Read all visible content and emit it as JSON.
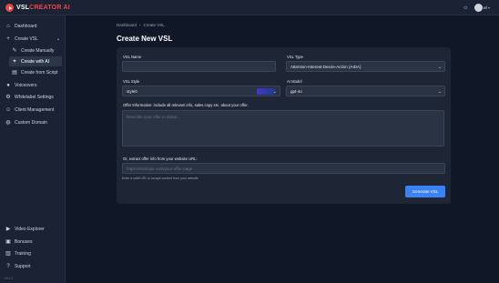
{
  "brand": {
    "name_part1": "VSL",
    "name_part2": "CREATOR AI",
    "color_accent": "#ef4444"
  },
  "topbar": {
    "user_name": "wl",
    "theme_icon": "sun-icon"
  },
  "sidebar": {
    "items": [
      {
        "label": "Dashboard",
        "icon": "home-icon"
      },
      {
        "label": "Create VSL",
        "icon": "plus-icon",
        "expanded": true
      },
      {
        "label": "Create Manually",
        "icon": "edit-icon"
      },
      {
        "label": "Create with AI",
        "icon": "sparkle-icon",
        "active": true
      },
      {
        "label": "Create from Script",
        "icon": "document-icon"
      },
      {
        "label": "Voiceovers",
        "icon": "microphone-icon"
      },
      {
        "label": "Whitelabel Settings",
        "icon": "gear-icon"
      },
      {
        "label": "Client Management",
        "icon": "users-icon"
      },
      {
        "label": "Custom Domain",
        "icon": "globe-icon"
      }
    ],
    "bottom_items": [
      {
        "label": "Video Explorer",
        "icon": "video-icon"
      },
      {
        "label": "Bonuses",
        "icon": "gift-icon"
      },
      {
        "label": "Training",
        "icon": "book-icon"
      },
      {
        "label": "Support",
        "icon": "help-icon"
      }
    ],
    "version": "v0.1.1"
  },
  "breadcrumb": {
    "home": "Dashboard",
    "separator": "›",
    "current": "Create VSL"
  },
  "page_title": "Create New VSL",
  "form": {
    "vsl_name": {
      "label": "VSL Name",
      "value": ""
    },
    "vsl_type": {
      "label": "VSL Type",
      "value": "Attention-Interest-Desire-Action (AIDA)"
    },
    "vsl_style": {
      "label": "VSL Style",
      "value": "style0",
      "swatch_color": "#4338ca"
    },
    "ai_model": {
      "label": "AI Model",
      "value": "gpt-4o"
    },
    "offer_info": {
      "label": "Offer Information: include all relevant info, sales copy etc. about your offer.",
      "placeholder": "Describe your offer in detail..."
    },
    "website_url": {
      "label": "Or, extract offer info from your website URL:",
      "placeholder": "https://example.com/your-offer-page",
      "hint": "Enter a valid URL to scrape content from your website"
    },
    "submit_label": "Generate VSL"
  },
  "colors": {
    "primary": "#3b82f6",
    "background": "#101828",
    "panel": "#1e2636"
  }
}
